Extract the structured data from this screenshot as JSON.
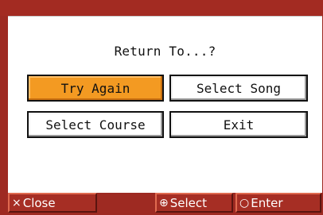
{
  "dialog": {
    "title": "Return To...?",
    "buttons": {
      "try_again": "Try Again",
      "select_song": "Select Song",
      "select_course": "Select Course",
      "exit": "Exit"
    },
    "selected": "try_again"
  },
  "function_keys": {
    "close": {
      "icon": "close-x-icon",
      "glyph": "×",
      "label": "Close"
    },
    "select": {
      "icon": "dial-icon",
      "glyph": "⊕",
      "label": "Select"
    },
    "enter": {
      "icon": "circle-icon",
      "glyph": "○",
      "label": "Enter"
    }
  },
  "colors": {
    "frame": "#9e2a22",
    "highlight": "#f39a22",
    "panel": "#ffffff"
  }
}
